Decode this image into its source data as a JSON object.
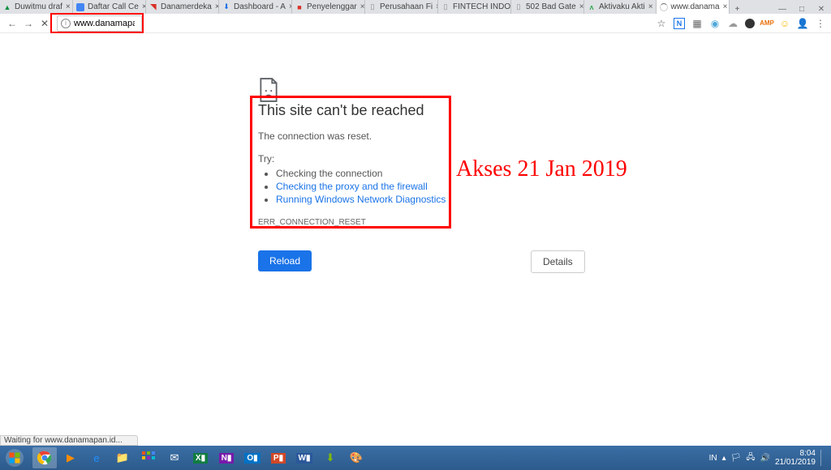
{
  "window_controls": {
    "minimize": "—",
    "maximize": "□",
    "close": "✕"
  },
  "tabs": [
    {
      "title": "Duwitmu draf",
      "active": false
    },
    {
      "title": "Daftar Call Ce",
      "active": false
    },
    {
      "title": "Danamerdeka",
      "active": false
    },
    {
      "title": "Dashboard - A",
      "active": false
    },
    {
      "title": "Penyelenggar",
      "active": false
    },
    {
      "title": "Perusahaan Fi",
      "active": false
    },
    {
      "title": "FINTECH INDO",
      "active": false
    },
    {
      "title": "502 Bad Gate",
      "active": false
    },
    {
      "title": "Aktivaku Akti",
      "active": false
    },
    {
      "title": "www.danama",
      "active": true
    }
  ],
  "omnibox": {
    "url": "www.danamapan.id"
  },
  "toolbar_icons": [
    "star-icon",
    "n-icon",
    "grid-icon",
    "drop-icon",
    "cloud-icon",
    "circle-icon",
    "amp-icon",
    "smile-icon",
    "user-icon",
    "menu-icon"
  ],
  "error_page": {
    "heading": "This site can't be reached",
    "subline": "The connection was reset.",
    "try_label": "Try:",
    "suggestions": [
      {
        "text": "Checking the connection",
        "link": false
      },
      {
        "text": "Checking the proxy and the firewall",
        "link": true
      },
      {
        "text": "Running Windows Network Diagnostics",
        "link": true
      }
    ],
    "error_code": "ERR_CONNECTION_RESET",
    "reload_label": "Reload",
    "details_label": "Details"
  },
  "annotation": "Akses 21 Jan 2019",
  "status_bar": "Waiting for www.danamapan.id...",
  "tray": {
    "language": "IN",
    "time": "8:04",
    "date": "21/01/2019"
  }
}
